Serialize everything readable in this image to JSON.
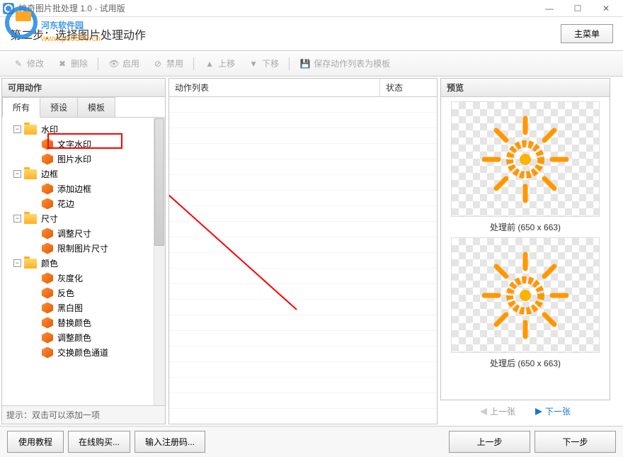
{
  "app": {
    "title": "神奇图片批处理 1.0 - 试用版"
  },
  "watermark": {
    "line1": "河东软件园",
    "line2": "www.pc0359.cn"
  },
  "step": {
    "title": "第二步：选择图片处理动作",
    "main_menu": "主菜单"
  },
  "toolbar": {
    "modify": "修改",
    "delete": "删除",
    "enable": "启用",
    "disable": "禁用",
    "move_up": "上移",
    "move_down": "下移",
    "save_template": "保存动作列表为模板"
  },
  "left": {
    "header": "可用动作",
    "tabs": [
      "所有",
      "预设",
      "模板"
    ],
    "hint": "提示：双击可以添加一项",
    "tree": [
      {
        "cat": "水印",
        "items": [
          "文字水印",
          "图片水印"
        ]
      },
      {
        "cat": "边框",
        "items": [
          "添加边框",
          "花边"
        ]
      },
      {
        "cat": "尺寸",
        "items": [
          "调整尺寸",
          "限制图片尺寸"
        ]
      },
      {
        "cat": "颜色",
        "items": [
          "灰度化",
          "反色",
          "黑白图",
          "替换颜色",
          "调整颜色",
          "交换颜色通道"
        ]
      }
    ]
  },
  "mid": {
    "col_actions": "动作列表",
    "col_state": "状态"
  },
  "right": {
    "header": "预览",
    "before": "处理前",
    "after": "处理后",
    "dims": "(650 x 663)",
    "prev": "上一张",
    "next": "下一张"
  },
  "bottom": {
    "tutorial": "使用教程",
    "buy": "在线购买...",
    "register": "输入注册码...",
    "prev_step": "上一步",
    "next_step": "下一步"
  }
}
